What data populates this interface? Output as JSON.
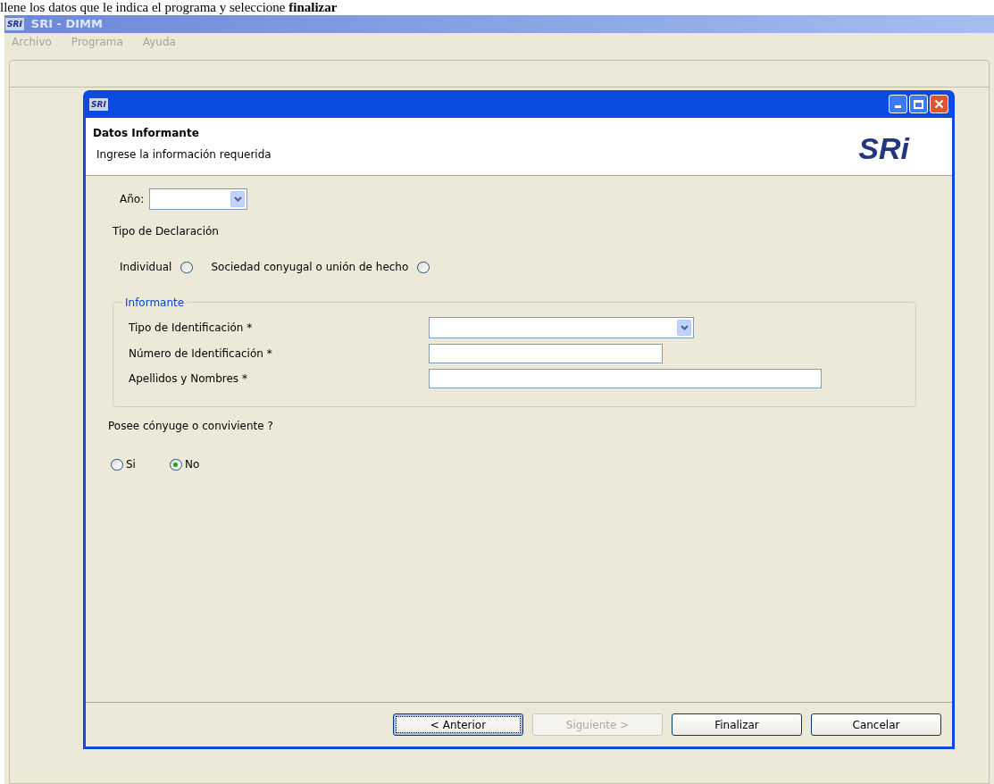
{
  "caption": "llene los datos que le indica el programa y seleccione **finalizar**",
  "app": {
    "title": "SRI - DIMM",
    "logo": "SRI",
    "menu": [
      "Archivo",
      "Programa",
      "Ayuda"
    ]
  },
  "dialog": {
    "logo": "SRI",
    "header_title": "Datos Informante",
    "header_subtitle": "Ingrese la información requerida",
    "header_logo": "SRi",
    "year": {
      "label": "Año:"
    },
    "declaration_type": {
      "label": "Tipo de Declaración",
      "options": [
        {
          "label": "Individual",
          "selected": false
        },
        {
          "label": "Sociedad conyugal o unión de hecho",
          "selected": false
        }
      ]
    },
    "informante": {
      "legend": "Informante",
      "fields": [
        {
          "kind": "select",
          "label": "Tipo de Identificación *"
        },
        {
          "kind": "text",
          "label": "Número de Identificación *"
        },
        {
          "kind": "wide",
          "label": "Apellidos y Nombres *"
        }
      ]
    },
    "spouse": {
      "label": "Posee cónyuge o conviviente ?",
      "options": [
        {
          "label": "Si",
          "selected": false
        },
        {
          "label": "No",
          "selected": true
        }
      ]
    },
    "buttons": [
      {
        "label": "< Anterior",
        "disabled": false,
        "focused": true
      },
      {
        "label": "Siguiente >",
        "disabled": true,
        "focused": false
      },
      {
        "label": "Finalizar",
        "disabled": false,
        "focused": false
      },
      {
        "label": "Cancelar",
        "disabled": false,
        "focused": false
      }
    ]
  }
}
